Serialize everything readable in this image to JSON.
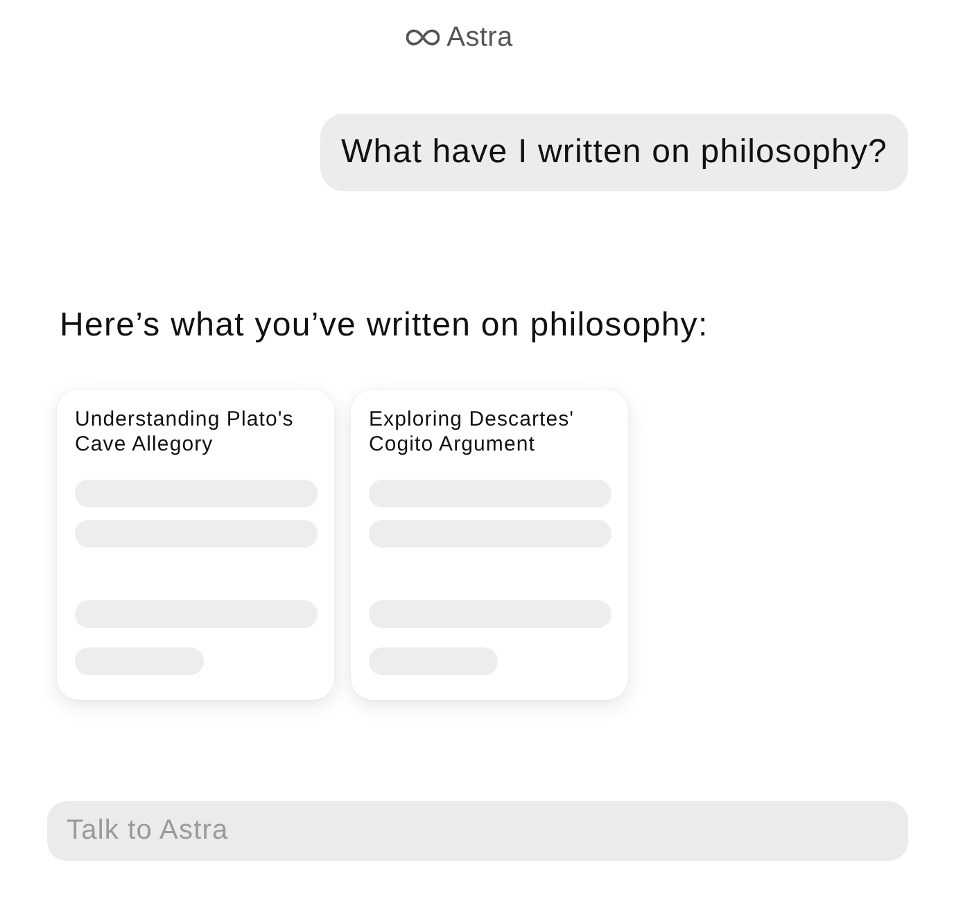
{
  "header": {
    "title": "Astra"
  },
  "question": {
    "text": "What have I written on philosophy?"
  },
  "answer": {
    "text": "Here’s what you’ve written on philosophy:",
    "cards": [
      {
        "title": "Understanding Plato's Cave Allegory"
      },
      {
        "title": "Exploring Descartes' Cogito Argument"
      }
    ]
  },
  "composer": {
    "placeholder": "Talk to Astra"
  }
}
